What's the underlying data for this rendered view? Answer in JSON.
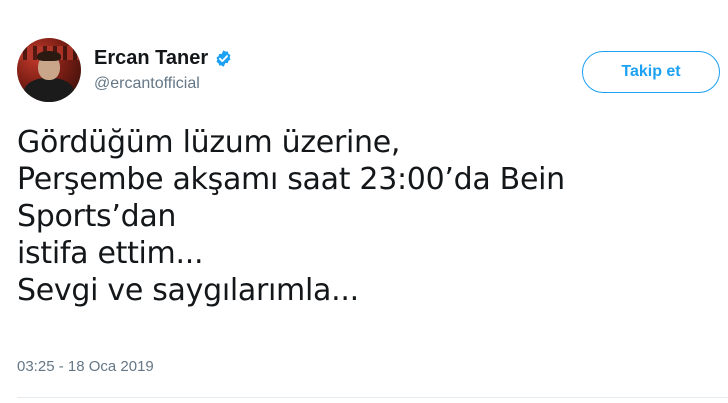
{
  "author": {
    "display_name": "Ercan Taner",
    "handle": "@ercantofficial",
    "verified": true
  },
  "follow_button": {
    "label": "Takip et"
  },
  "tweet": {
    "lines": [
      "Gördüğüm lüzum üzerine,",
      "Perşembe akşamı saat 23:00’da Bein",
      "Sports’dan",
      "istifa ettim...",
      "Sevgi ve saygılarımla..."
    ],
    "timestamp": "03:25 - 18 Oca 2019"
  },
  "colors": {
    "accent": "#1da1f2",
    "secondary_text": "#657786",
    "primary_text": "#14171a"
  },
  "icons": {
    "verified": "verified-badge-icon",
    "avatar": "profile-photo"
  }
}
